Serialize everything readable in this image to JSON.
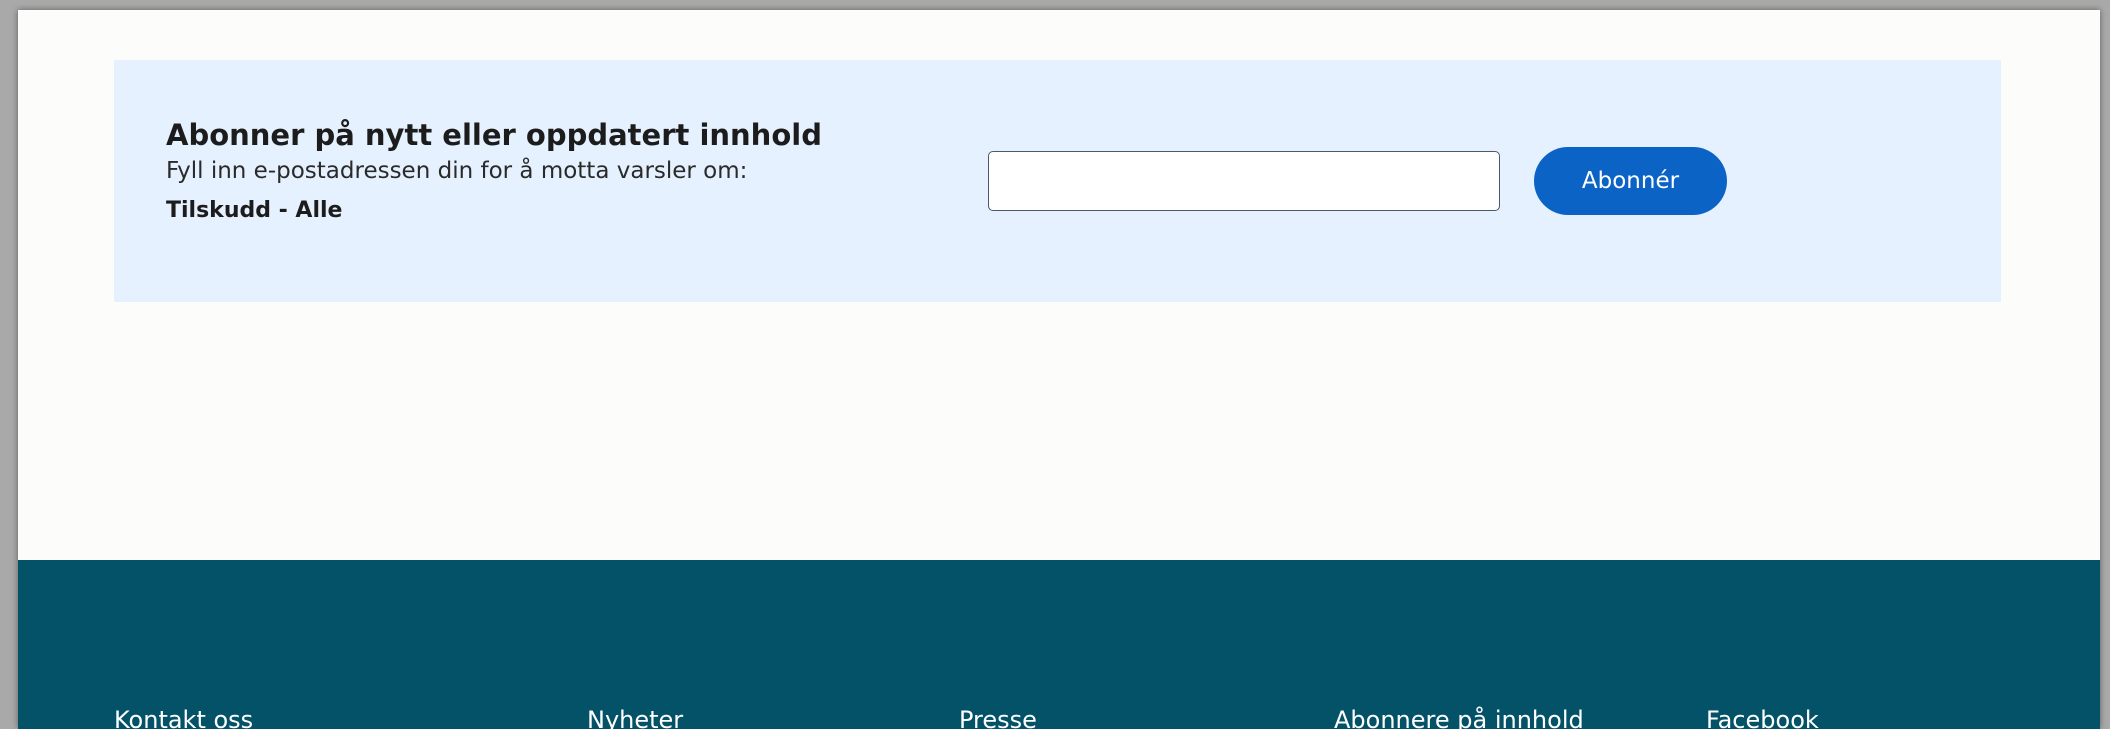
{
  "subscribe": {
    "title": "Abonner på nytt eller oppdatert innhold",
    "description": "Fyll inn e-postadressen din for å motta varsler om:",
    "topic": "Tilskudd - Alle",
    "email_value": "",
    "email_placeholder": "",
    "button_label": "Abonnér"
  },
  "footer": {
    "links": [
      {
        "label": "Kontakt oss"
      },
      {
        "label": "Nyheter"
      },
      {
        "label": "Presse"
      },
      {
        "label": "Abonnere på innhold"
      },
      {
        "label": "Facebook"
      }
    ]
  },
  "colors": {
    "panel_background": "#e5f1fe",
    "button_background": "#0b63c6",
    "footer_background": "#045268"
  }
}
